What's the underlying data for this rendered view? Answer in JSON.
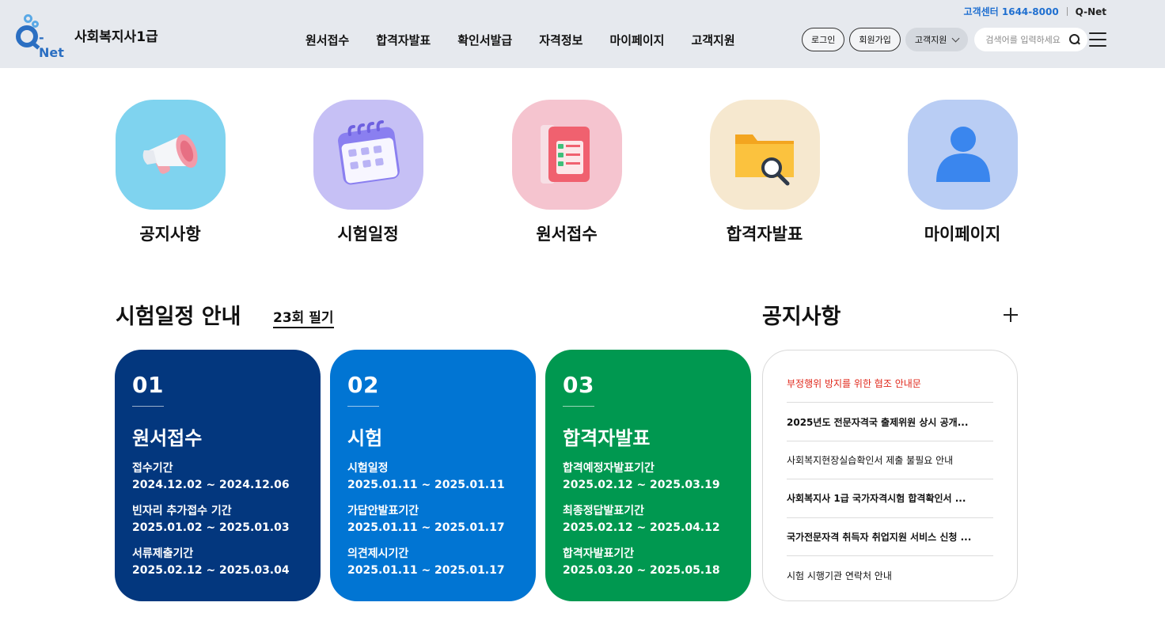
{
  "header": {
    "customer_center": "고객센터 1644-8000",
    "qnet_link": "Q-Net",
    "logo_text": "-Net",
    "site_title": "사회복지사1급",
    "nav": [
      "원서접수",
      "합격자발표",
      "확인서발급",
      "자격정보",
      "마이페이지",
      "고객지원"
    ],
    "login": "로그인",
    "signup": "회원가입",
    "support": "고객지원",
    "search_placeholder": "검색어를 입력하세요"
  },
  "quick_menu": [
    {
      "label": "공지사항",
      "icon": "megaphone-icon"
    },
    {
      "label": "시험일정",
      "icon": "calendar-icon"
    },
    {
      "label": "원서접수",
      "icon": "checklist-icon"
    },
    {
      "label": "합격자발표",
      "icon": "folder-search-icon"
    },
    {
      "label": "마이페이지",
      "icon": "user-icon"
    }
  ],
  "schedule": {
    "title": "시험일정 안내",
    "tab": "23회 필기",
    "cards": [
      {
        "num": "01",
        "title": "원서접수",
        "color": "#03377e",
        "rows": [
          {
            "label": "접수기간",
            "value": "2024.12.02 ~ 2024.12.06"
          },
          {
            "label": "빈자리 추가접수 기간",
            "value": "2025.01.02 ~ 2025.01.03"
          },
          {
            "label": "서류제출기간",
            "value": "2025.02.12 ~ 2025.03.04"
          }
        ]
      },
      {
        "num": "02",
        "title": "시험",
        "color": "#0175d3",
        "rows": [
          {
            "label": "시험일정",
            "value": "2025.01.11 ~ 2025.01.11"
          },
          {
            "label": "가답안발표기간",
            "value": "2025.01.11 ~ 2025.01.17"
          },
          {
            "label": "의견제시기간",
            "value": "2025.01.11 ~ 2025.01.17"
          }
        ]
      },
      {
        "num": "03",
        "title": "합격자발표",
        "color": "#009850",
        "rows": [
          {
            "label": "합격예정자발표기간",
            "value": "2025.02.12 ~ 2025.03.19"
          },
          {
            "label": "최종정답발표기간",
            "value": "2025.02.12 ~ 2025.04.12"
          },
          {
            "label": "합격자발표기간",
            "value": "2025.03.20 ~ 2025.05.18"
          }
        ]
      }
    ]
  },
  "notice": {
    "title": "공지사항",
    "items": [
      {
        "text": "부정행위 방지를 위한 협조 안내문",
        "style": "red"
      },
      {
        "text": "2025년도 전문자격국 출제위원 상시 공개...",
        "style": "bold"
      },
      {
        "text": "사회복지현장실습확인서 제출 불필요 안내",
        "style": "normal"
      },
      {
        "text": "사회복지사 1급 국가자격시험 합격확인서 ...",
        "style": "bold"
      },
      {
        "text": "국가전문자격 취득자 취업지원 서비스 신청 ...",
        "style": "bold"
      },
      {
        "text": "시험 시행기관 연락처 안내",
        "style": "normal"
      }
    ]
  }
}
